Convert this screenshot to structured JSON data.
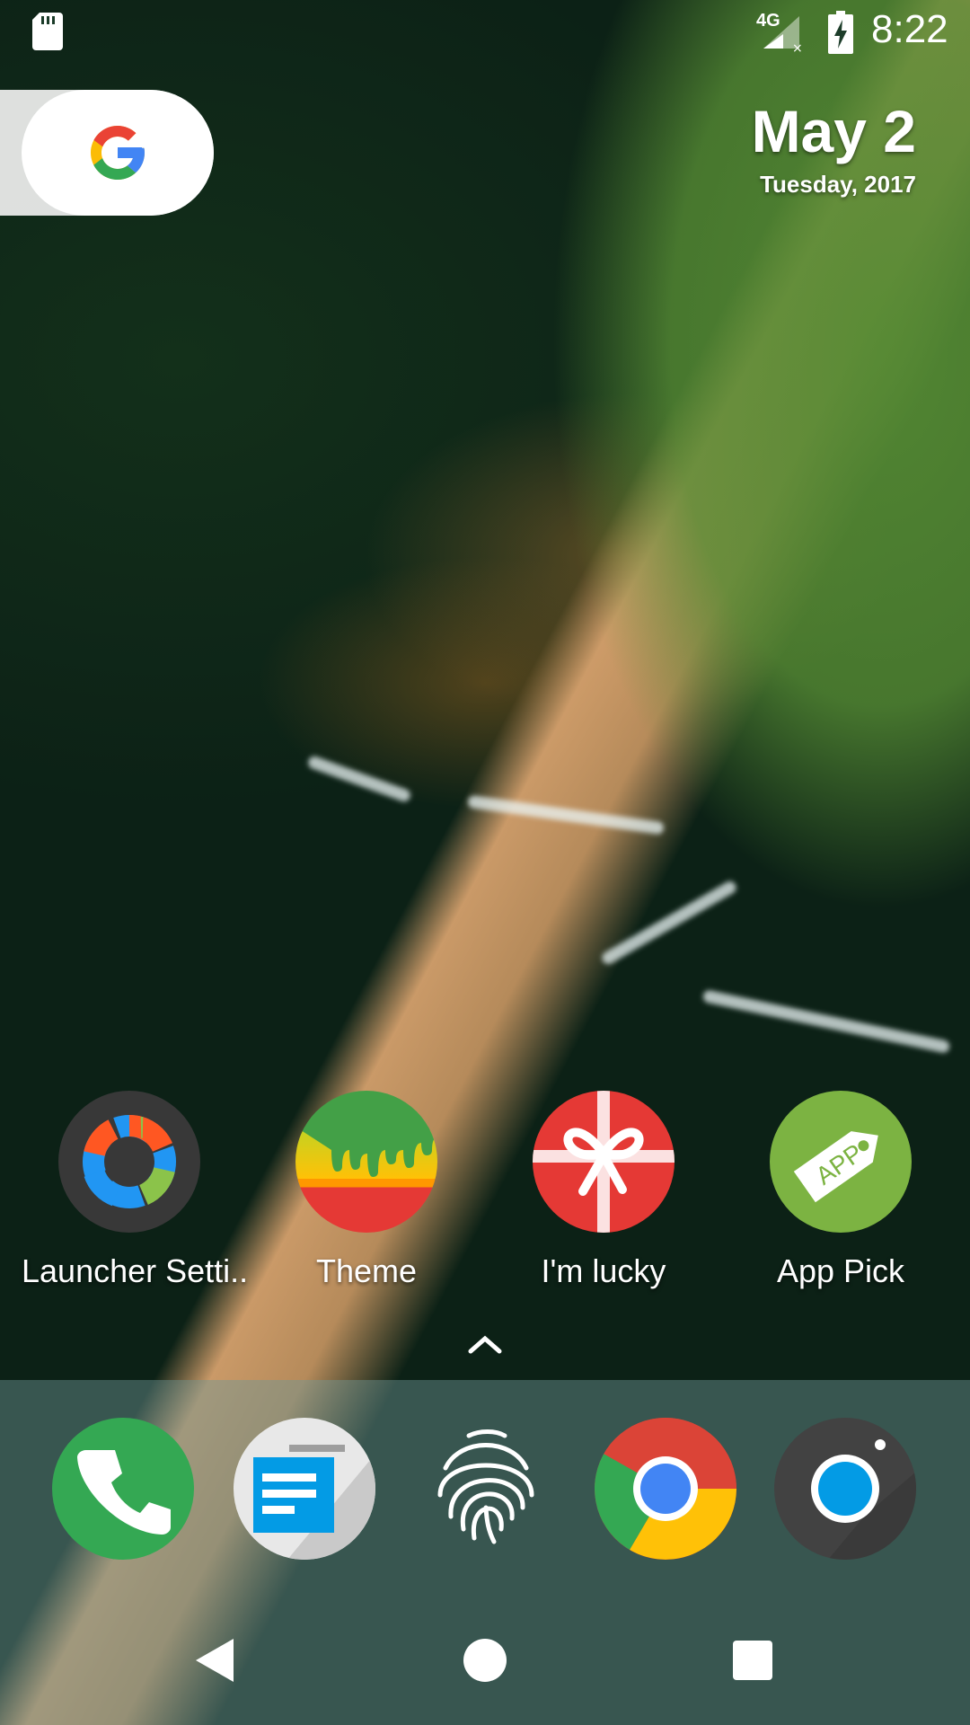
{
  "status_bar": {
    "network_label": "4G",
    "time": "8:22",
    "icons": [
      "sd-card-icon",
      "signal-icon",
      "battery-charging-icon"
    ]
  },
  "search": {
    "widget_icon": "google-g-icon"
  },
  "date_widget": {
    "date": "May 2",
    "weekday_year": "Tuesday, 2017"
  },
  "apps": [
    {
      "label": "Launcher Setti..",
      "icon": "launcher-settings-icon"
    },
    {
      "label": "Theme",
      "icon": "theme-icon"
    },
    {
      "label": "I'm lucky",
      "icon": "gift-icon"
    },
    {
      "label": "App Pick",
      "icon": "app-tag-icon"
    }
  ],
  "app_drawer_handle": {
    "icon": "chevron-up-icon"
  },
  "dock": {
    "apps": [
      "phone-icon",
      "messages-icon",
      "fingerprint-icon",
      "chrome-icon",
      "camera-icon"
    ]
  },
  "navigation": {
    "icons": [
      "back-icon",
      "home-icon",
      "recents-icon"
    ]
  },
  "colors": {
    "google_blue": "#4285F4",
    "google_red": "#EA4335",
    "google_yellow": "#FBBC05",
    "google_green": "#34A853",
    "phone_green": "#34A853",
    "camera_blue": "#039BE5",
    "app_pick_green": "#7CB342",
    "gift_red": "#E53935"
  }
}
